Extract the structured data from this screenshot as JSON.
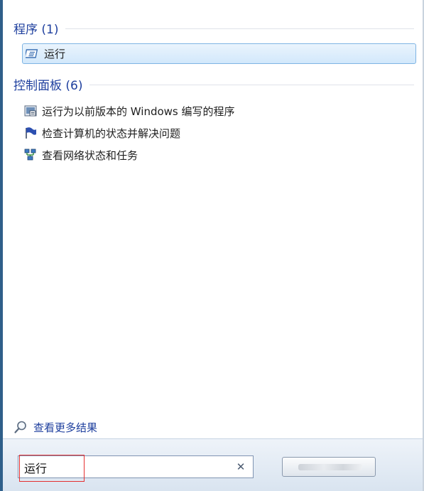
{
  "sections": {
    "programs": {
      "title": "程序 (1)",
      "items": [
        {
          "label": "运行",
          "icon": "run-dialog-icon",
          "selected": true
        }
      ]
    },
    "control_panel": {
      "title": "控制面板 (6)",
      "items": [
        {
          "label": "运行为以前版本的 Windows 编写的程序",
          "icon": "compatibility-icon"
        },
        {
          "label": "检查计算机的状态并解决问题",
          "icon": "action-center-flag-icon"
        },
        {
          "label": "查看网络状态和任务",
          "icon": "network-icon"
        }
      ]
    }
  },
  "see_more": {
    "label": "查看更多结果",
    "icon": "search-icon"
  },
  "search": {
    "value": "运行",
    "clear_icon": "close-icon"
  },
  "colors": {
    "header_blue": "#1e3f9e",
    "selection_border": "#7eb4e3",
    "highlight_red": "#e53030"
  }
}
